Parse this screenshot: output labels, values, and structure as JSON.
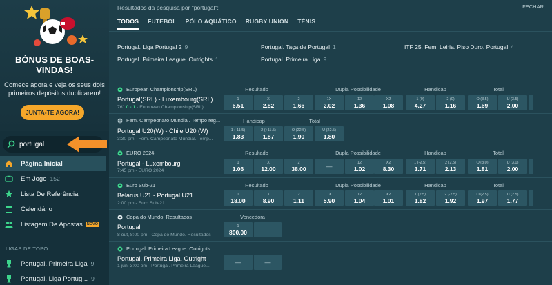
{
  "promo": {
    "title": "BÓNUS DE BOAS-VINDAS!",
    "text": "Comece agora e veja os seus dois primeiros depósitos duplicarem!",
    "button": "JUNTA-TE AGORA!"
  },
  "search": {
    "value": "portugal"
  },
  "nav": {
    "home": "Página Inicial",
    "live": "Em Jogo",
    "live_count": "152",
    "favorites": "Lista De Referência",
    "calendar": "Calendário",
    "bets": "Listagem De Apostas",
    "bets_badge": "NOVO"
  },
  "top_leagues": {
    "title": "LIGAS DE TOPO",
    "items": [
      {
        "label": "Portugal. Primeira Liga",
        "count": "9"
      },
      {
        "label": "Portugal. Liga Portug...",
        "count": "9"
      }
    ]
  },
  "main": {
    "results_title": "Resultados da pesquisa por \"portugal\":",
    "close": "FECHAR",
    "tabs": [
      "TODOS",
      "FUTEBOL",
      "PÓLO AQUÁTICO",
      "RUGBY UNION",
      "TÉNIS"
    ],
    "competitions": [
      {
        "label": "Portugal. Liga Portugal 2",
        "count": "9"
      },
      {
        "label": "Portugal. Taça de Portugal",
        "count": "1"
      },
      {
        "label": "ITF 25. Fem. Leiria. Piso Duro. Portugal",
        "count": "4"
      },
      {
        "label": "Portugal. Primeira League. Outrights",
        "count": "1"
      },
      {
        "label": "Portugal. Primeira Liga",
        "count": "9"
      }
    ]
  },
  "headers": {
    "resultado": "Resultado",
    "dupla": "Dupla Possibilidade",
    "handicap": "Handicap",
    "total": "Total",
    "vencedora": "Vencedora"
  },
  "events": [
    {
      "league": "European Championship(SRL)",
      "name": "Portugal(SRL) - Luxembourg(SRL)",
      "minute": "76'",
      "score": "0 - 1",
      "sub": "European Championship(SRL)",
      "res": [
        [
          "1",
          "6.51"
        ],
        [
          "X",
          "2.82"
        ],
        [
          "2",
          "1.66"
        ]
      ],
      "dupla": [
        [
          "1X",
          "2.02"
        ],
        [
          "12",
          "1.36"
        ],
        [
          "X2",
          "1.08"
        ]
      ],
      "hcp": [
        [
          "1 (0)",
          "4.27"
        ],
        [
          "2 (0)",
          "1.16"
        ]
      ],
      "tot": [
        [
          "O (3.5)",
          "1.69"
        ],
        [
          "U (3.5)",
          "2.00"
        ]
      ]
    },
    {
      "league": "Fem. Campeonato Mundial. Tempo reg...",
      "name": "Portugal U20(W) - Chile U20 (W)",
      "sub": "3:30 pm - Fem. Campeonato Mundial. Temp...",
      "hcp": [
        [
          "1 (-11.5)",
          "1.83"
        ],
        [
          "2 (+11.5)",
          "1.87"
        ]
      ],
      "tot": [
        [
          "O (22.5)",
          "1.90"
        ],
        [
          "U (22.5)",
          "1.80"
        ]
      ]
    },
    {
      "league": "EURO 2024",
      "name": "Portugal - Luxembourg",
      "sub": "7:45 pm - EURO 2024",
      "res": [
        [
          "1",
          "1.06"
        ],
        [
          "X",
          "12.00"
        ],
        [
          "2",
          "38.00"
        ]
      ],
      "dupla": [
        [
          "12",
          "1.02"
        ],
        [
          "X2",
          "8.30"
        ]
      ],
      "hcp": [
        [
          "1 (-2.5)",
          "1.71"
        ],
        [
          "2 (2.5)",
          "2.13"
        ]
      ],
      "tot": [
        [
          "O (3.0)",
          "1.81"
        ],
        [
          "U (3.0)",
          "2.00"
        ]
      ]
    },
    {
      "league": "Euro Sub-21",
      "name": "Belarus U21 - Portugal U21",
      "sub": "2:00 pm - Euro Sub-21",
      "res": [
        [
          "1",
          "18.00"
        ],
        [
          "X",
          "8.90"
        ],
        [
          "2",
          "1.11"
        ]
      ],
      "dupla": [
        [
          "1X",
          "5.90"
        ],
        [
          "12",
          "1.04"
        ],
        [
          "X2",
          "1.01"
        ]
      ],
      "hcp": [
        [
          "1 (2.5)",
          "1.82"
        ],
        [
          "2 (-2.5)",
          "1.92"
        ]
      ],
      "tot": [
        [
          "O (2.5)",
          "1.97"
        ],
        [
          "U (2.5)",
          "1.77"
        ]
      ]
    },
    {
      "league": "Copa do Mundo. Resultados",
      "name": "Portugal",
      "sub": "8 out, 8:00 pm - Copa do Mundo. Resultados",
      "winner": [
        [
          "1",
          "800.00"
        ]
      ]
    },
    {
      "league": "Portugal. Primeira League. Outrights",
      "name": "Portugal. Primeira Liga. Outright",
      "sub": "1 jun, 3:00 pm - Portugal. Primeira League..."
    }
  ],
  "colors": {
    "accent": "#f5a72a",
    "live_score": "#3dd68c",
    "odd_bg": "#2c5663"
  }
}
